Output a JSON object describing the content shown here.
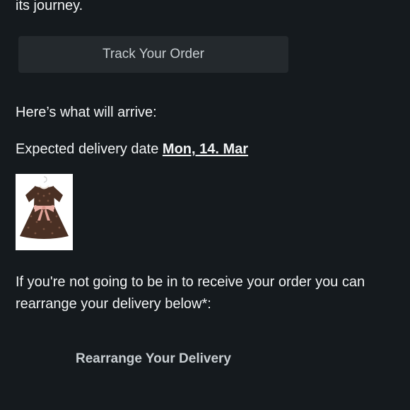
{
  "email": {
    "intro_tail": "its journey.",
    "track_button_label": "Track Your Order",
    "arrive_heading": "Here’s what will arrive:",
    "delivery_prefix": "Expected delivery date ",
    "delivery_date": "Mon, 14. Mar",
    "product_image_icon": "dress-product-image",
    "notice_text": "If you're not going to be in to receive your order you can rearrange your delivery below*:",
    "rearrange_button_label": "Rearrange Your Delivery"
  },
  "colors": {
    "background": "#151a1e",
    "button_background": "#24292d",
    "text": "#f2f4f5",
    "button_text": "#c7cdd1"
  }
}
